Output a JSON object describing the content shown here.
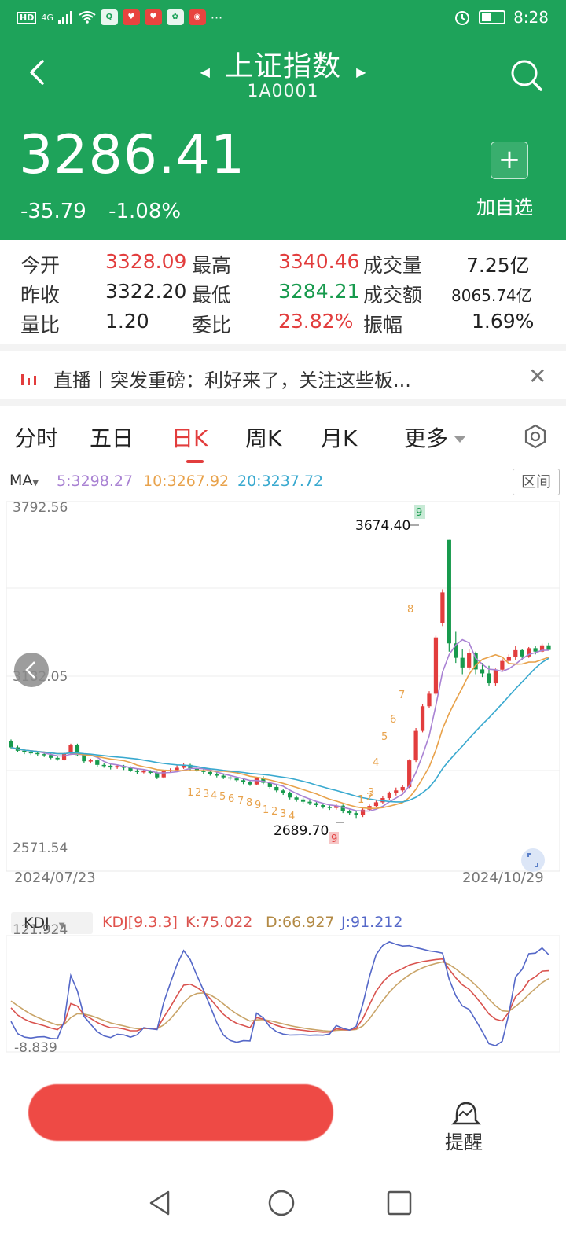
{
  "status": {
    "time": "8:28",
    "network": "4G",
    "hd": "HD",
    "more": "···"
  },
  "nav": {
    "title": "上证指数",
    "code": "1A0001"
  },
  "quote_head": {
    "price": "3286.41",
    "change": "-35.79",
    "change_pct": "-1.08%",
    "add_label": "加自选"
  },
  "quote_table": {
    "open_label": "今开",
    "open": "3328.09",
    "high_label": "最高",
    "high": "3340.46",
    "volume_label": "成交量",
    "volume": "7.25亿",
    "prev_label": "昨收",
    "prev": "3322.20",
    "low_label": "最低",
    "low": "3284.21",
    "amount_label": "成交额",
    "amount": "8065.74亿",
    "vol_ratio_label": "量比",
    "vol_ratio": "1.20",
    "bid_ratio_label": "委比",
    "bid_ratio": "23.82%",
    "amplitude_label": "振幅",
    "amplitude": "1.69%"
  },
  "news": {
    "text": "直播丨突发重磅：利好来了，关注这些板..."
  },
  "tabs": [
    "分时",
    "五日",
    "日K",
    "周K",
    "月K",
    "更多"
  ],
  "active_tab": 2,
  "ma": {
    "selector": "MA",
    "ma5": "5:3298.27",
    "ma10": "10:3267.92",
    "ma20": "20:3237.72",
    "range_button": "区间"
  },
  "kline_labels": {
    "y_top": "3792.56",
    "y_mid": "3182.05",
    "y_bottom": "2571.54",
    "x_start": "2024/07/23",
    "x_end": "2024/10/29",
    "max_label": "3674.40",
    "min_label": "2689.70"
  },
  "kdj": {
    "selector": "KDJ",
    "param": "KDJ[9.3.3]",
    "k": "K:75.022",
    "d": "D:66.927",
    "j": "J:91.212",
    "y_top": "121.924",
    "y_bottom": "-8.839"
  },
  "bottom": {
    "remind_label": "提醒"
  },
  "colors": {
    "up": "#e23d3d",
    "down": "#179a4d",
    "header": "#1ea35a",
    "ma5": "#a982d3",
    "ma10": "#e8a24b",
    "ma20": "#39a9cf"
  },
  "chart_data": {
    "type": "candlestick",
    "x_start": "2024/07/23",
    "x_end": "2024/10/29",
    "ylim": [
      2571.54,
      3792.56
    ],
    "labels": {
      "max": 3674.4,
      "min": 2689.7
    },
    "candles": [
      [
        2965,
        2942,
        2970,
        2938
      ],
      [
        2942,
        2930,
        2948,
        2925
      ],
      [
        2930,
        2925,
        2936,
        2918
      ],
      [
        2925,
        2922,
        2930,
        2915
      ],
      [
        2922,
        2918,
        2928,
        2910
      ],
      [
        2918,
        2915,
        2925,
        2908
      ],
      [
        2915,
        2905,
        2920,
        2900
      ],
      [
        2905,
        2900,
        2910,
        2895
      ],
      [
        2898,
        2920,
        2925,
        2895
      ],
      [
        2920,
        2950,
        2955,
        2915
      ],
      [
        2950,
        2915,
        2955,
        2910
      ],
      [
        2915,
        2893,
        2920,
        2888
      ],
      [
        2893,
        2896,
        2902,
        2885
      ],
      [
        2896,
        2880,
        2900,
        2872
      ],
      [
        2880,
        2877,
        2886,
        2870
      ],
      [
        2877,
        2871,
        2882,
        2864
      ],
      [
        2871,
        2876,
        2880,
        2866
      ],
      [
        2876,
        2870,
        2880,
        2862
      ],
      [
        2870,
        2860,
        2875,
        2855
      ],
      [
        2860,
        2855,
        2866,
        2848
      ],
      [
        2855,
        2858,
        2864,
        2850
      ],
      [
        2858,
        2852,
        2862,
        2846
      ],
      [
        2852,
        2836,
        2856,
        2830
      ],
      [
        2836,
        2858,
        2862,
        2832
      ],
      [
        2858,
        2862,
        2868,
        2852
      ],
      [
        2862,
        2870,
        2878,
        2858
      ],
      [
        2870,
        2880,
        2885,
        2866
      ],
      [
        2880,
        2868,
        2884,
        2860
      ],
      [
        2868,
        2860,
        2872,
        2855
      ],
      [
        2860,
        2855,
        2864,
        2848
      ],
      [
        2855,
        2848,
        2860,
        2842
      ],
      [
        2848,
        2842,
        2854,
        2836
      ],
      [
        2842,
        2836,
        2848,
        2830
      ],
      [
        2836,
        2832,
        2842,
        2826
      ],
      [
        2832,
        2826,
        2838,
        2820
      ],
      [
        2826,
        2820,
        2832,
        2812
      ],
      [
        2820,
        2811,
        2826,
        2806
      ],
      [
        2811,
        2835,
        2838,
        2808
      ],
      [
        2835,
        2817,
        2840,
        2812
      ],
      [
        2817,
        2802,
        2822,
        2796
      ],
      [
        2802,
        2790,
        2808,
        2784
      ],
      [
        2790,
        2780,
        2796,
        2774
      ],
      [
        2780,
        2765,
        2786,
        2758
      ],
      [
        2765,
        2758,
        2772,
        2750
      ],
      [
        2758,
        2750,
        2764,
        2742
      ],
      [
        2750,
        2745,
        2756,
        2738
      ],
      [
        2745,
        2738,
        2750,
        2730
      ],
      [
        2738,
        2732,
        2744,
        2726
      ],
      [
        2732,
        2728,
        2738,
        2721
      ],
      [
        2728,
        2736,
        2742,
        2722
      ],
      [
        2736,
        2717,
        2740,
        2710
      ],
      [
        2717,
        2710,
        2722,
        2704
      ],
      [
        2710,
        2702,
        2716,
        2690
      ],
      [
        2702,
        2722,
        2728,
        2696
      ],
      [
        2722,
        2735,
        2740,
        2718
      ],
      [
        2735,
        2748,
        2754,
        2730
      ],
      [
        2748,
        2763,
        2770,
        2742
      ],
      [
        2763,
        2780,
        2786,
        2756
      ],
      [
        2780,
        2790,
        2800,
        2772
      ],
      [
        2790,
        2802,
        2810,
        2784
      ],
      [
        2802,
        2896,
        2900,
        2798
      ],
      [
        2896,
        3000,
        3010,
        2890
      ],
      [
        3000,
        3087,
        3095,
        2995
      ],
      [
        3087,
        3131,
        3140,
        3080
      ],
      [
        3131,
        3330,
        3336,
        3125
      ],
      [
        3380,
        3489,
        3500,
        3370
      ],
      [
        3674,
        3309,
        3674,
        3280
      ],
      [
        3309,
        3258,
        3350,
        3240
      ],
      [
        3258,
        3224,
        3290,
        3200
      ],
      [
        3224,
        3276,
        3290,
        3215
      ],
      [
        3276,
        3217,
        3280,
        3200
      ],
      [
        3217,
        3203,
        3240,
        3190
      ],
      [
        3203,
        3168,
        3230,
        3160
      ],
      [
        3168,
        3216,
        3220,
        3160
      ],
      [
        3216,
        3247,
        3255,
        3210
      ],
      [
        3247,
        3262,
        3270,
        3240
      ],
      [
        3262,
        3285,
        3300,
        3250
      ],
      [
        3285,
        3263,
        3290,
        3250
      ],
      [
        3263,
        3292,
        3296,
        3258
      ],
      [
        3292,
        3280,
        3300,
        3270
      ],
      [
        3280,
        3302,
        3308,
        3275
      ],
      [
        3302,
        3286,
        3310,
        3284
      ]
    ]
  }
}
